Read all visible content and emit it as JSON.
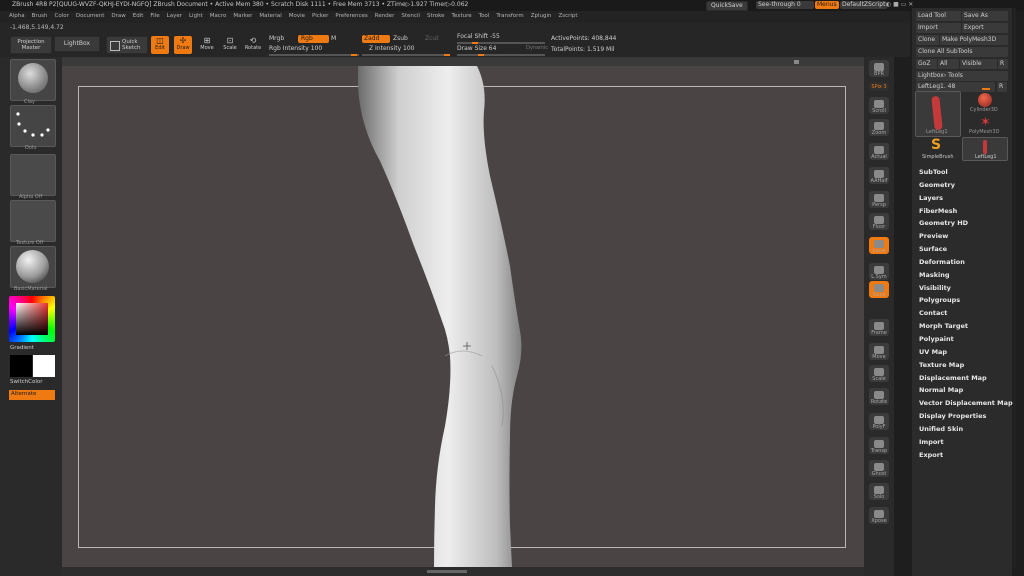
{
  "title_bar": {
    "text": "ZBrush 4R8 P2[QUUG-WVZF-QKHJ-EYDI-NGFQ]   ZBrush Document   • Active Mem 380 • Scratch Disk 1111 • Free Mem 3713 • ZTime▷1.927 Timer▷0.062",
    "quicksave": "QuickSave",
    "see_through": "See-through  0",
    "menus": "Menus",
    "script": "DefaultZScript"
  },
  "menu_bar": [
    "Alpha",
    "Brush",
    "Color",
    "Document",
    "Draw",
    "Edit",
    "File",
    "Layer",
    "Light",
    "Macro",
    "Marker",
    "Material",
    "Movie",
    "Picker",
    "Preferences",
    "Render",
    "Stencil",
    "Stroke",
    "Texture",
    "Tool",
    "Transform",
    "Zplugin",
    "Zscript"
  ],
  "coords": "-1.468,5.149,4.72",
  "toolbar": {
    "projection_master": "Projection Master",
    "lightbox": "LightBox",
    "quick_sketch": "Quick Sketch",
    "edit": "Edit",
    "draw": "Draw",
    "move": "Move",
    "scale": "Scale",
    "rotate": "Rotate",
    "mrgb": "Mrgb",
    "rgb": "Rgb",
    "m": "M",
    "rgb_intensity": "Rgb Intensity 100",
    "zadd": "Zadd",
    "zsub": "Zsub",
    "zcut": "Zcut",
    "z_intensity": "Z Intensity 100",
    "focal_shift": "Focal Shift -55",
    "draw_size": "Draw Size 64",
    "dynamic": "Dynamic",
    "active_points": "ActivePoints: 408,844",
    "total_points": "TotalPoints: 1.519 Mil"
  },
  "left_shelf": {
    "brush_label": "Clay",
    "stroke_label": "Dots",
    "alpha_label": "Alpha Off",
    "texture_label": "Texture Off",
    "material_label": "BasicMaterial",
    "gradient": "Gradient",
    "switch_color": "SwitchColor",
    "alternate": "Alternate"
  },
  "right_shelf": [
    {
      "name": "bpr",
      "label": "BPR"
    },
    {
      "name": "spix",
      "label": "SPix 3"
    },
    {
      "name": "scroll",
      "label": "Scroll"
    },
    {
      "name": "zoom",
      "label": "Zoom"
    },
    {
      "name": "actual",
      "label": "Actual"
    },
    {
      "name": "aahalf",
      "label": "AAHalf"
    },
    {
      "name": "persp",
      "label": "Persp"
    },
    {
      "name": "floor",
      "label": "Floor"
    },
    {
      "name": "local",
      "label": "Local"
    },
    {
      "name": "lsym",
      "label": "L.Sym"
    },
    {
      "name": "xyz",
      "label": "Gxyz"
    },
    {
      "name": "frame",
      "label": "Frame"
    },
    {
      "name": "move",
      "label": "Move"
    },
    {
      "name": "scale",
      "label": "Scale"
    },
    {
      "name": "rotate",
      "label": "Rotate"
    },
    {
      "name": "polyf",
      "label": "PolyF"
    },
    {
      "name": "transp",
      "label": "Transp"
    },
    {
      "name": "ghost",
      "label": "Ghost"
    },
    {
      "name": "solo",
      "label": "Solo"
    },
    {
      "name": "xpose",
      "label": "Xpose"
    }
  ],
  "tool_panel": {
    "load_tool": "Load Tool",
    "save_as": "Save As",
    "import": "Import",
    "export": "Export",
    "clone": "Clone",
    "make_polymesh": "Make PolyMesh3D",
    "clone_all": "Clone All SubTools",
    "goz": "GoZ",
    "all": "All",
    "visible": "Visible",
    "r": "R",
    "lightbox_tools": "Lightbox› Tools",
    "current_tool": "LeftLeg1. 48",
    "thumbs": [
      "LeftLeg1",
      "Cylinder3D",
      "PolyMesh3D",
      "SimpleBrush",
      "LeftLeg1"
    ],
    "sections": [
      "SubTool",
      "Geometry",
      "Layers",
      "FiberMesh",
      "Geometry HD",
      "Preview",
      "Surface",
      "Deformation",
      "Masking",
      "Visibility",
      "Polygroups",
      "Contact",
      "Morph Target",
      "Polypaint",
      "UV Map",
      "Texture Map",
      "Displacement Map",
      "Normal Map",
      "Vector Displacement Map",
      "Display Properties",
      "Unified Skin",
      "Import",
      "Export"
    ]
  },
  "colors": {
    "accent": "#f07a12",
    "canvas": "#4a4444",
    "ui_bg": "#2a2a2a"
  }
}
